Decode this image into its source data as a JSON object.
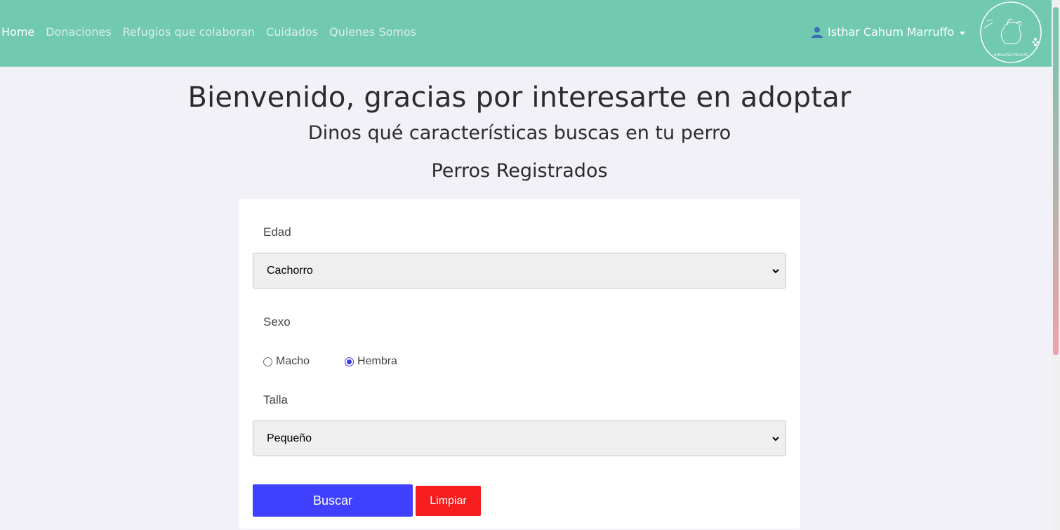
{
  "nav": {
    "links": [
      "Home",
      "Donaciones",
      "Refugios que colaboran",
      "Cuidados",
      "Quienes Somos"
    ],
    "user_name": "Isthar Cahum Marruffo",
    "logo_text": "HUELLITAS FELICES",
    "bg_color": "#71c9b0"
  },
  "headings": {
    "title": "Bienvenido, gracias por interesarte en adoptar",
    "subtitle": "Dinos qué características buscas en tu perro",
    "section": "Perros Registrados"
  },
  "form": {
    "edad_label": "Edad",
    "edad_value": "Cachorro",
    "sexo_label": "Sexo",
    "sexo_options": [
      "Macho",
      "Hembra"
    ],
    "sexo_selected": "Hembra",
    "talla_label": "Talla",
    "talla_value": "Pequeño",
    "buscar_label": "Buscar",
    "limpiar_label": "Limpiar",
    "buscar_color": "#4040ff",
    "limpiar_color": "#f51d1d"
  }
}
